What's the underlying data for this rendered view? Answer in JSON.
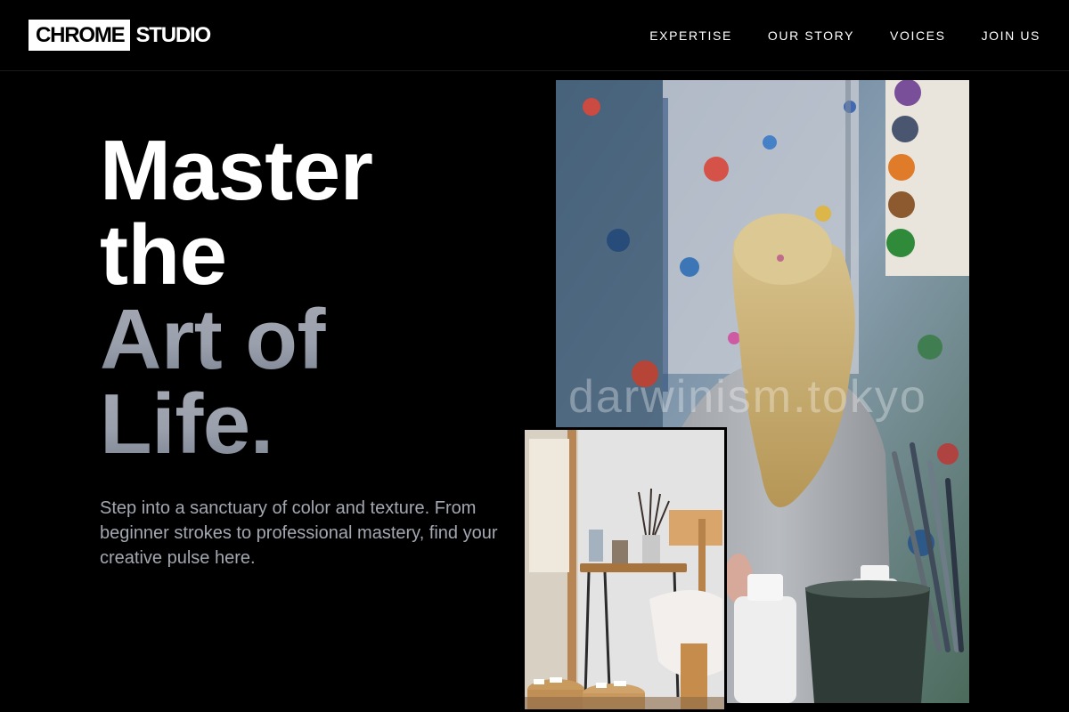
{
  "brand": {
    "box_text": "CHROME",
    "text": "STUDIO"
  },
  "nav": {
    "items": [
      {
        "label": "EXPERTISE"
      },
      {
        "label": "OUR STORY"
      },
      {
        "label": "VOICES"
      },
      {
        "label": "JOIN US"
      }
    ]
  },
  "hero": {
    "headline": {
      "line1": "Master",
      "line2": "the",
      "line3": "Art of",
      "line4": "Life."
    },
    "lead": "Step into a sanctuary of color and texture. From beginner strokes to professional mastery, find your creative pulse here."
  },
  "images": {
    "main": {
      "subject": "girl with blonde ponytail facing paint-splattered studio wall",
      "watermark": "darwinism.tokyo"
    },
    "secondary": {
      "subject": "art studio corner with easel, brushes in jar and paint tubes"
    }
  },
  "colors": {
    "background": "#000000",
    "text": "#ffffff",
    "headline_accent": "#9aa0ac",
    "lead_text": "#a3a7b0"
  }
}
